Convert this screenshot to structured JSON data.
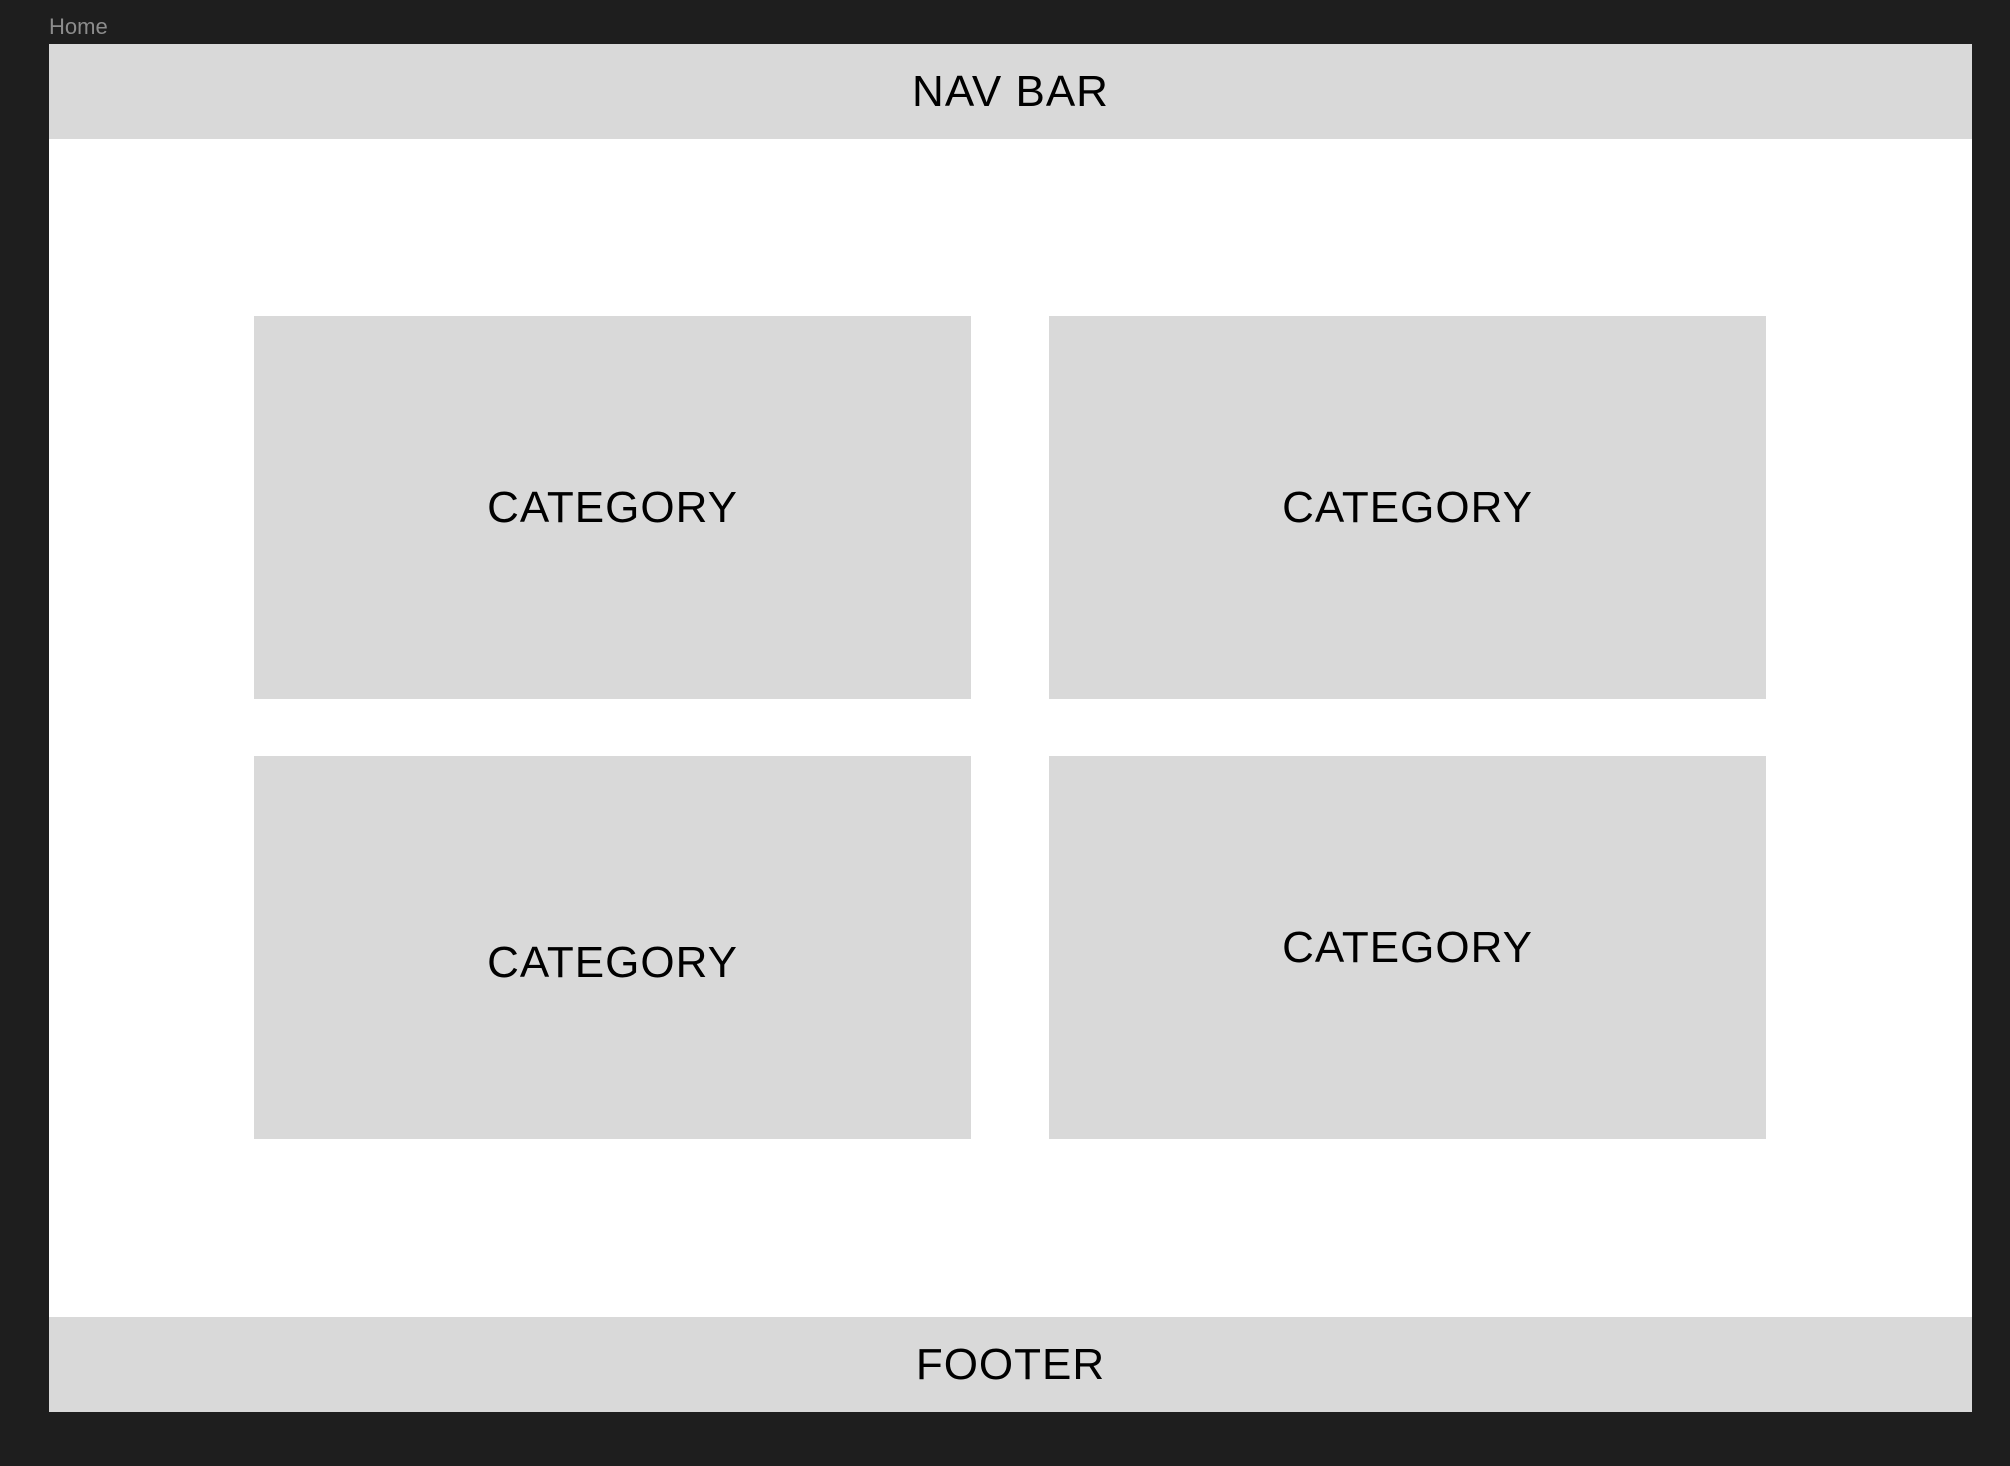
{
  "frame": {
    "label": "Home"
  },
  "navbar": {
    "label": "NAV BAR"
  },
  "categories": [
    {
      "label": "CATEGORY"
    },
    {
      "label": "CATEGORY"
    },
    {
      "label": "CATEGORY"
    },
    {
      "label": "CATEGORY"
    }
  ],
  "footer": {
    "label": "FOOTER"
  },
  "colors": {
    "canvas": "#1e1e1e",
    "frame": "#ffffff",
    "placeholder": "#d9d9d9",
    "text": "#000000",
    "frame_label": "#8c8c8c"
  }
}
